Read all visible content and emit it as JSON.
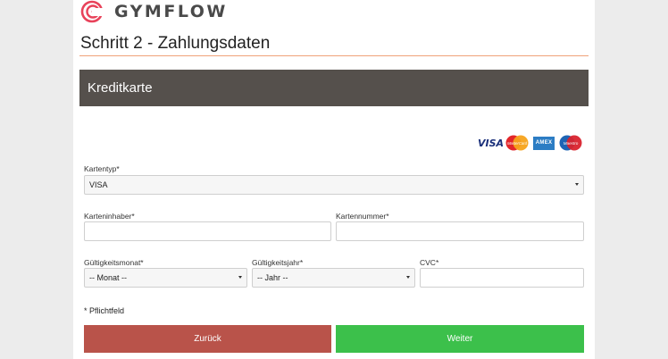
{
  "brand": {
    "name": "GYMFLOW",
    "accent_color": "#e8425a"
  },
  "page": {
    "title": "Schritt 2 - Zahlungsdaten"
  },
  "section": {
    "title": "Kreditkarte"
  },
  "card_logos": [
    {
      "name": "visa-logo",
      "text": "VISA"
    },
    {
      "name": "mastercard-logo",
      "text": "MasterCard"
    },
    {
      "name": "amex-logo",
      "text": "AMEX"
    },
    {
      "name": "maestro-logo",
      "text": "Maestro"
    }
  ],
  "form": {
    "card_type": {
      "label": "Kartentyp*",
      "value": "VISA"
    },
    "card_holder": {
      "label": "Karteninhaber*",
      "value": ""
    },
    "card_number": {
      "label": "Kartennummer*",
      "value": ""
    },
    "expiry_month": {
      "label": "Gültigkeitsmonat*",
      "value": "-- Monat --"
    },
    "expiry_year": {
      "label": "Gültigkeitsjahr*",
      "value": "-- Jahr --"
    },
    "cvc": {
      "label": "CVC*",
      "value": ""
    },
    "required_note": "* Pflichtfeld"
  },
  "buttons": {
    "back": "Zurück",
    "next": "Weiter"
  }
}
